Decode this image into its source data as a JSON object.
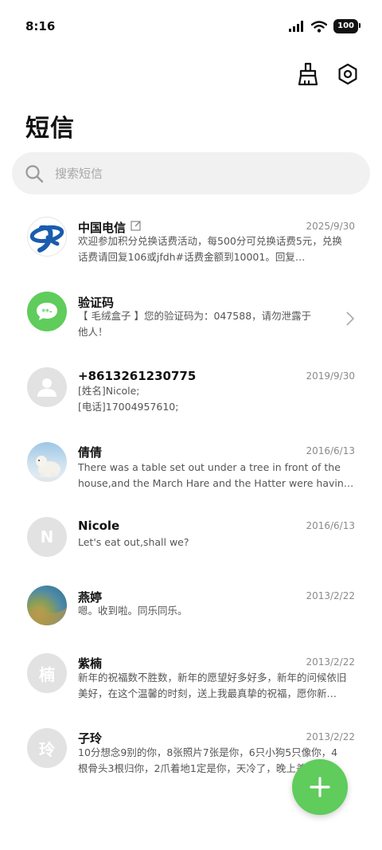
{
  "status_bar": {
    "time": "8:16",
    "battery": "100"
  },
  "header": {
    "title": "短信",
    "clean_icon": "brush-icon",
    "settings_icon": "settings-hex-icon"
  },
  "search": {
    "placeholder": "搜索短信"
  },
  "messages": [
    {
      "sender": "中国电信",
      "date": "2025/9/30",
      "line1": "欢迎参加积分兑换话费活动，每500分可兑换话费5元，兑换",
      "line2": "话费请回复106或jfdh#话费金额到10001。回复…",
      "avatar": "china-telecom-logo"
    },
    {
      "sender": "验证码",
      "date": "",
      "line1": "【 毛绒盒子 】您的验证码为：047588，请勿泄露于",
      "line2": "他人！",
      "avatar": "verification-code-icon"
    },
    {
      "sender": "+8613261230775",
      "date": "2019/9/30",
      "line1": "[姓名]Nicole;",
      "line2": "[电话]17004957610;",
      "avatar": "person-icon"
    },
    {
      "sender": "倩倩",
      "date": "2016/6/13",
      "line1": "There was a table set out under a tree in front of the",
      "line2": "house,and the March Hare and the Hatter were having…",
      "avatar": "polar-bear-photo"
    },
    {
      "sender": "Nicole",
      "date": "2016/6/13",
      "line1": "Let's eat out,shall we?",
      "line2": "",
      "avatar_letter": "N"
    },
    {
      "sender": "燕婷",
      "date": "2013/2/22",
      "line1": "嗯。收到啦。同乐同乐。",
      "line2": "",
      "avatar": "landscape-photo"
    },
    {
      "sender": "紫楠",
      "date": "2013/2/22",
      "line1": "新年的祝福数不胜数，新年的愿望好多好多，新年的问候依旧",
      "line2": "美好，在这个温馨的时刻，送上我最真挚的祝福，愿你新…",
      "avatar_letter": "楠"
    },
    {
      "sender": "子玲",
      "date": "2013/2/22",
      "line1": "10分想念9别的你，8张照片7张是你，6只小狗5只像你，4",
      "line2": "根骨头3根归你，2爪着地1定是你，天冷了，晚上盖好…",
      "avatar_letter": "玲"
    }
  ],
  "fab": {
    "icon": "plus-icon"
  }
}
